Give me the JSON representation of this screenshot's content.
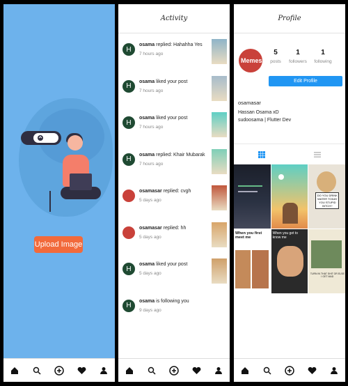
{
  "upload": {
    "button_label": "Upload Image"
  },
  "activity": {
    "title": "Activity",
    "items": [
      {
        "avatar": "H",
        "user": "osama",
        "text": " replied: Hahahha Yes",
        "time": "7 hours ago"
      },
      {
        "avatar": "H",
        "user": "osama",
        "text": " liked your post",
        "time": "7 hours ago"
      },
      {
        "avatar": "H",
        "user": "osama",
        "text": " liked your post",
        "time": "7 hours ago"
      },
      {
        "avatar": "H",
        "user": "osama",
        "text": " replied: Khair Mubarak",
        "time": "7 hours ago"
      },
      {
        "avatar": "",
        "user": "osamasar",
        "text": " replied: cvgh",
        "time": "5 days ago"
      },
      {
        "avatar": "",
        "user": "osamasar",
        "text": " replied: hh",
        "time": "5 days ago"
      },
      {
        "avatar": "H",
        "user": "osama",
        "text": " liked your post",
        "time": "5 days ago"
      },
      {
        "avatar": "H",
        "user": "osama",
        "text": " is following you",
        "time": "9 days ago"
      }
    ]
  },
  "profile": {
    "title": "Profile",
    "avatar_text": "Memes",
    "posts": "5",
    "posts_label": "posts",
    "followers": "1",
    "followers_label": "followers",
    "following": "1",
    "following_label": "following",
    "edit_label": "Edit Profile",
    "username": "osamasar",
    "display_name": "Hassan Osama xD",
    "bio": "sudoosama | Flutter Dev",
    "grid_texts": {
      "t5": "DO YOU DRINK WATER TODAY YOU STUPID BITCH?",
      "t7": "When you first meet me",
      "t8": "When you get to know me",
      "t9": "TURN IN THAT SHIT OR ELSE I GET MAD"
    }
  },
  "colors": {
    "upload_bg": "#6db2ec",
    "upload_btn": "#f26a3b",
    "accent": "#2196f3"
  }
}
